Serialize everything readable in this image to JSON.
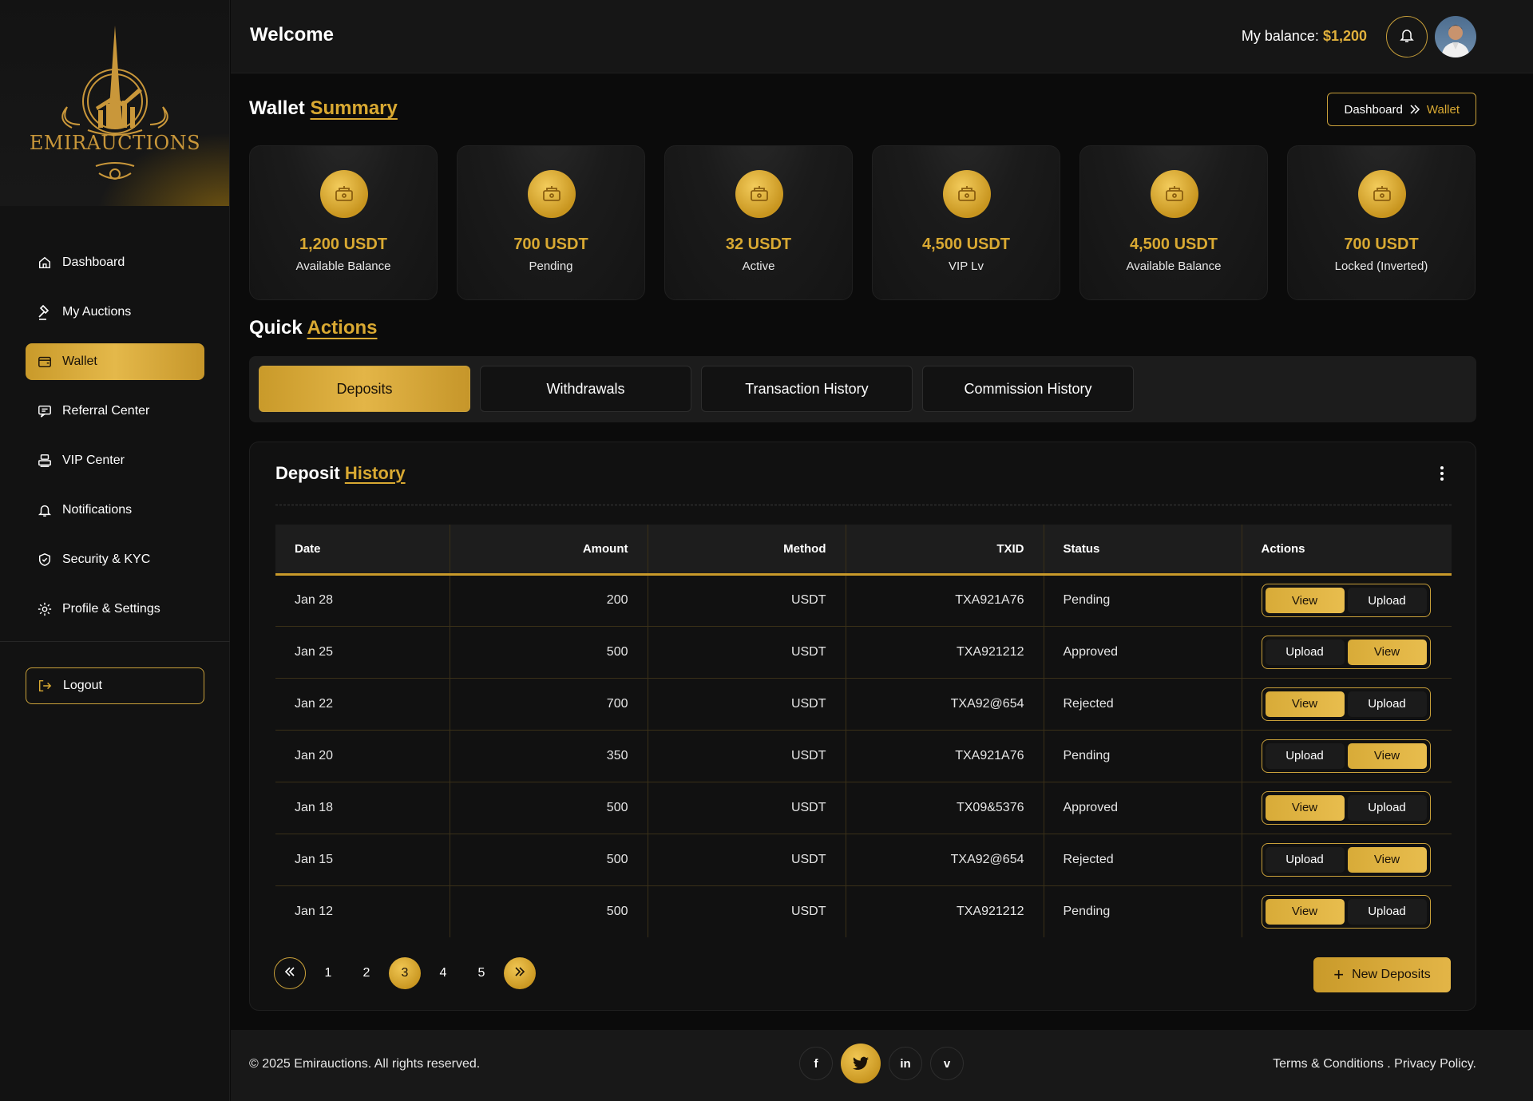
{
  "brand": {
    "name": "EMIRAUCTIONS"
  },
  "colors": {
    "accent": "#d9a932",
    "background": "#0b0b0b",
    "surface": "#141414"
  },
  "sidebar": {
    "items": [
      {
        "label": "Dashboard",
        "icon": "home-icon",
        "active": false
      },
      {
        "label": "My Auctions",
        "icon": "gavel-icon",
        "active": false
      },
      {
        "label": "Wallet",
        "icon": "wallet-icon",
        "active": true
      },
      {
        "label": "Referral Center",
        "icon": "referral-icon",
        "active": false
      },
      {
        "label": "VIP Center",
        "icon": "vip-icon",
        "active": false
      },
      {
        "label": "Notifications",
        "icon": "bell-icon",
        "active": false
      },
      {
        "label": "Security & KYC",
        "icon": "shield-icon",
        "active": false
      },
      {
        "label": "Profile & Settings",
        "icon": "gear-icon",
        "active": false
      }
    ],
    "logout": "Logout"
  },
  "header": {
    "title": "Welcome",
    "balance_label": "My balance:",
    "balance_value": "$1,200"
  },
  "wallet_summary": {
    "title": "Wallet",
    "title_accent": "Summary",
    "breadcrumb": [
      "Dashboard",
      "Wallet"
    ],
    "cards": [
      {
        "value": "1,200 USDT",
        "label": "Available Balance"
      },
      {
        "value": "700 USDT",
        "label": "Pending"
      },
      {
        "value": "32 USDT",
        "label": "Active"
      },
      {
        "value": "4,500 USDT",
        "label": "VIP Lv"
      },
      {
        "value": "4,500 USDT",
        "label": "Available Balance"
      },
      {
        "value": "700 USDT",
        "label": "Locked (Inverted)"
      }
    ]
  },
  "quick_actions": {
    "title": "Quick",
    "title_accent": "Actions",
    "tabs": [
      "Deposits",
      "Withdrawals",
      "Transaction History",
      "Commission History"
    ],
    "active_tab": 0
  },
  "deposit_history": {
    "title": "Deposit",
    "title_accent": "History",
    "columns": [
      "Date",
      "Amount",
      "Method",
      "TXID",
      "Status",
      "Actions"
    ],
    "rows": [
      {
        "date": "Jan 28",
        "amount": "200",
        "method": "USDT",
        "txid": "TXA921A76",
        "status": "Pending",
        "actions": [
          "View",
          "Upload"
        ],
        "highlight": 0
      },
      {
        "date": "Jan 25",
        "amount": "500",
        "method": "USDT",
        "txid": "TXA921212",
        "status": "Approved",
        "actions": [
          "Upload",
          "View"
        ],
        "highlight": 1
      },
      {
        "date": "Jan 22",
        "amount": "700",
        "method": "USDT",
        "txid": "TXA92@654",
        "status": "Rejected",
        "actions": [
          "View",
          "Upload"
        ],
        "highlight": 0
      },
      {
        "date": "Jan 20",
        "amount": "350",
        "method": "USDT",
        "txid": "TXA921A76",
        "status": "Pending",
        "actions": [
          "Upload",
          "View"
        ],
        "highlight": 1
      },
      {
        "date": "Jan 18",
        "amount": "500",
        "method": "USDT",
        "txid": "TX09&5376",
        "status": "Approved",
        "actions": [
          "View",
          "Upload"
        ],
        "highlight": 0
      },
      {
        "date": "Jan 15",
        "amount": "500",
        "method": "USDT",
        "txid": "TXA92@654",
        "status": "Rejected",
        "actions": [
          "Upload",
          "View"
        ],
        "highlight": 1
      },
      {
        "date": "Jan 12",
        "amount": "500",
        "method": "USDT",
        "txid": "TXA921212",
        "status": "Pending",
        "actions": [
          "View",
          "Upload"
        ],
        "highlight": 0
      }
    ],
    "pagination": {
      "pages": [
        "1",
        "2",
        "3",
        "4",
        "5"
      ],
      "current": "3"
    },
    "new_button": "New Deposits"
  },
  "footer": {
    "copyright": "© 2025 Emirauctions. All rights reserved.",
    "socials": [
      {
        "icon": "facebook-icon",
        "glyph": "f"
      },
      {
        "icon": "twitter-icon",
        "glyph": "🐦"
      },
      {
        "icon": "linkedin-icon",
        "glyph": "in"
      },
      {
        "icon": "vimeo-icon",
        "glyph": "v"
      }
    ],
    "links": "Terms & Conditions . Privacy Policy."
  }
}
